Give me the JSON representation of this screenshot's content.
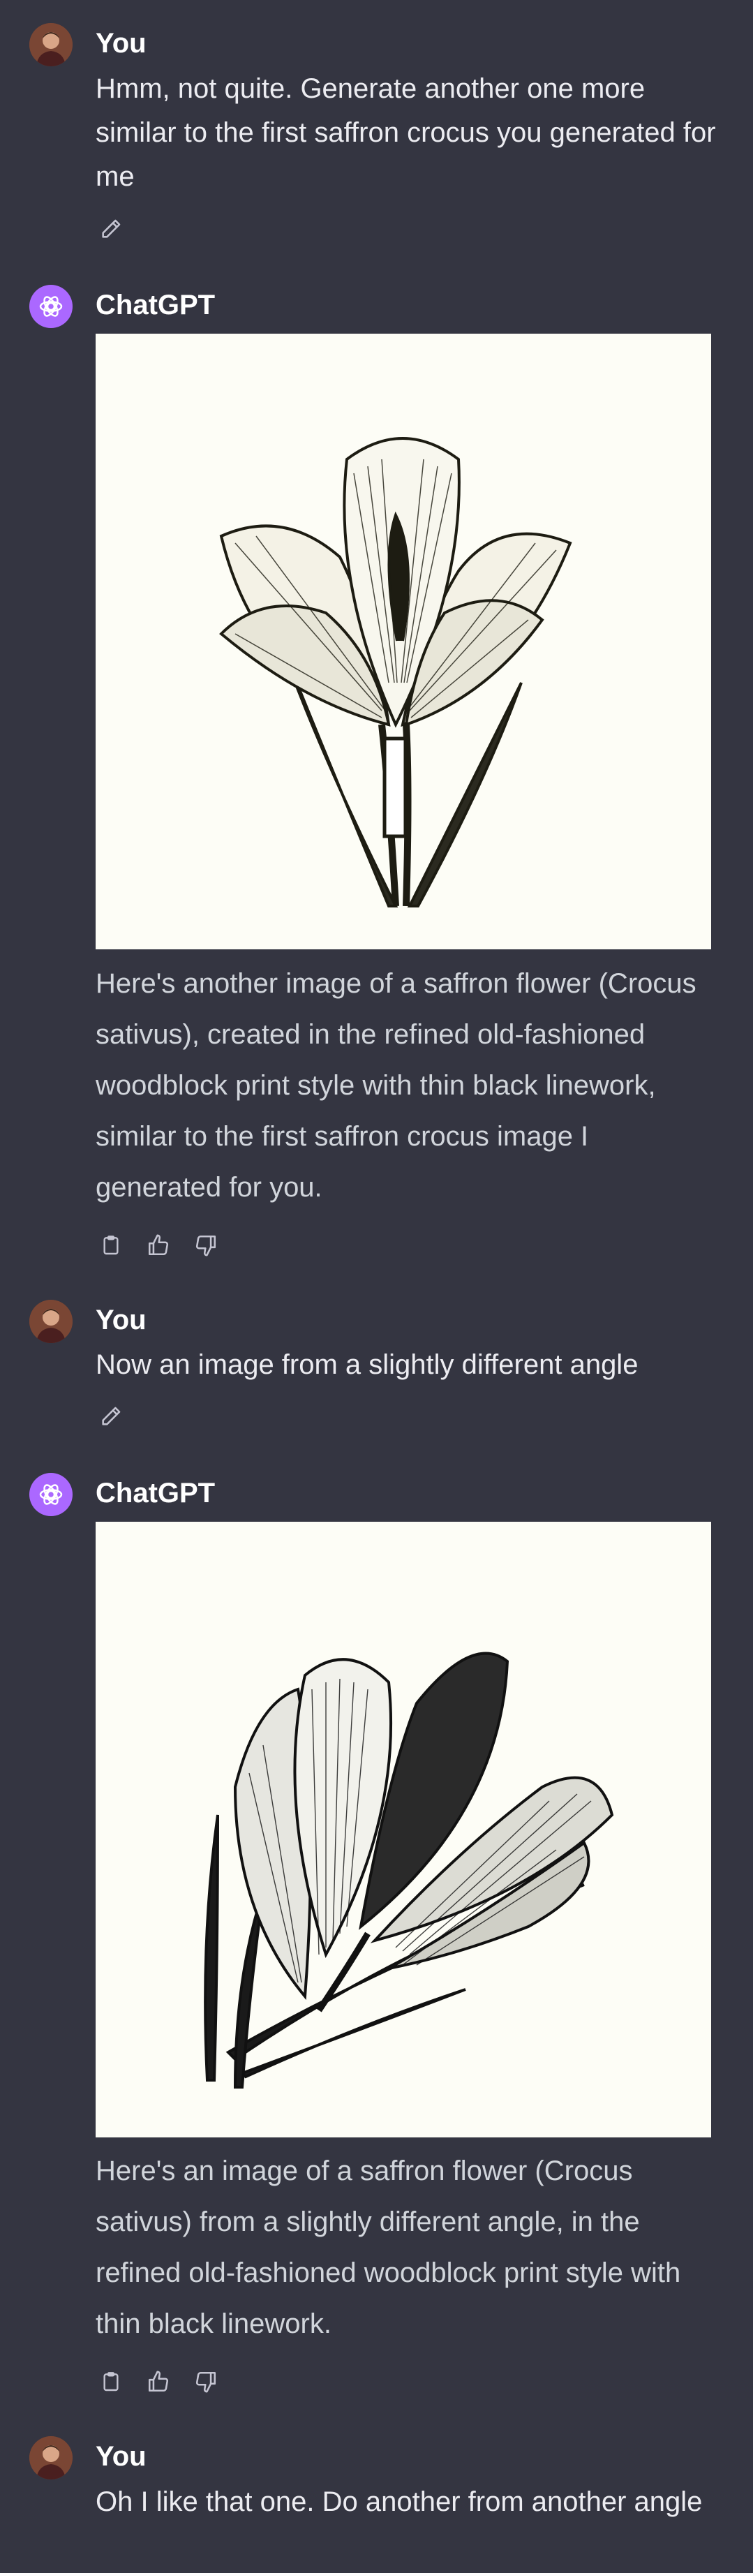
{
  "messages": [
    {
      "role": "user",
      "name": "You",
      "text": "Hmm, not quite.  Generate another one more similar to the first saffron crocus you generated for me"
    },
    {
      "role": "assistant",
      "name": "ChatGPT",
      "image_description_icon": "saffron-crocus-woodblock-image",
      "text": "Here's another image of a saffron flower (Crocus sativus), created in the refined old-fashioned woodblock print style with thin black linework, similar to the first saffron crocus image I generated for you."
    },
    {
      "role": "user",
      "name": "You",
      "text": "Now an image from a slightly different angle"
    },
    {
      "role": "assistant",
      "name": "ChatGPT",
      "image_description_icon": "saffron-crocus-angle-image",
      "text": "Here's an image of a saffron flower (Crocus sativus) from a slightly different angle, in the refined old-fashioned woodblock print style with thin black linework."
    },
    {
      "role": "user",
      "name": "You",
      "text": "Oh I like that one.  Do another from another angle"
    }
  ],
  "icons": {
    "edit": "pencil-icon",
    "copy": "clipboard-icon",
    "like": "thumbs-up-icon",
    "dislike": "thumbs-down-icon"
  },
  "colors": {
    "background": "#343541",
    "gpt_avatar": "#ab68ff",
    "image_background": "#fdfdf6"
  }
}
